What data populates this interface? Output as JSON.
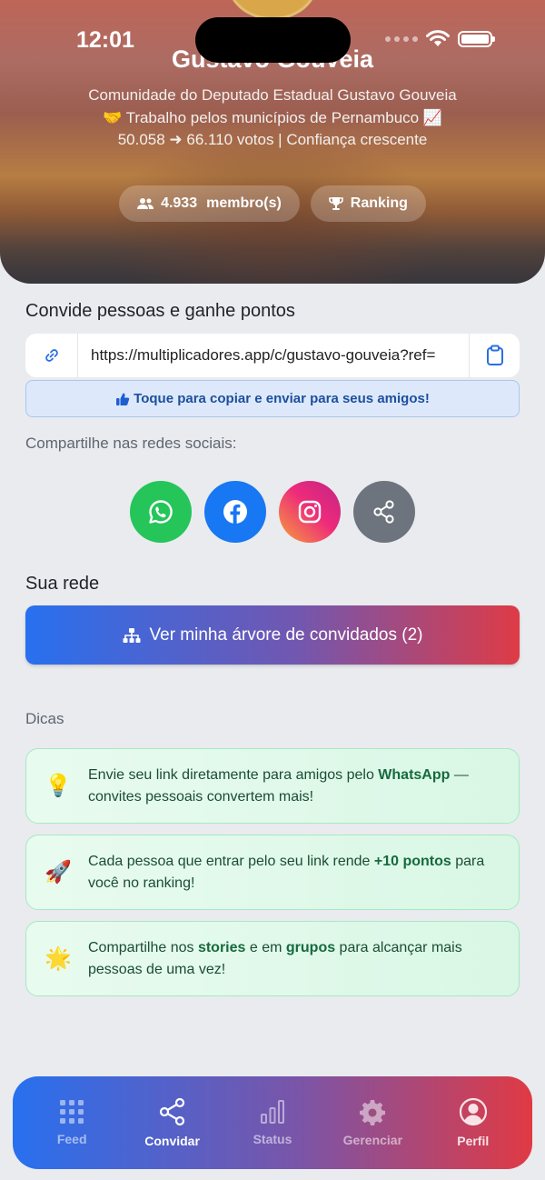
{
  "status_bar": {
    "time": "12:01"
  },
  "community": {
    "name": "Gustavo Gouveia",
    "description": "Comunidade do Deputado Estadual Gustavo Gouveia 🤝 Trabalho pelos municípios de Pernambuco 📈 50.058 ➜ 66.110 votos | Confiança crescente",
    "members_count": "4.933",
    "members_label": "membro(s)",
    "ranking_label": "Ranking"
  },
  "invite": {
    "title": "Convide pessoas e ganhe pontos",
    "link": "https://multiplicadores.app/c/gustavo-gouveia?ref=",
    "copy_hint": "Toque para copiar e enviar para seus amigos!",
    "social_label": "Compartilhe nas redes sociais:",
    "social": [
      {
        "name": "whatsapp",
        "color": "#25c55a"
      },
      {
        "name": "facebook",
        "color": "#1877f2"
      },
      {
        "name": "instagram",
        "color": "#e1306c"
      },
      {
        "name": "share",
        "color": "#6d747d"
      }
    ]
  },
  "network": {
    "title": "Sua rede",
    "tree_button": "Ver minha árvore de convidados (2)"
  },
  "tips": {
    "title": "Dicas",
    "items": [
      {
        "icon": "💡",
        "pre": "Envie seu link diretamente para amigos pelo ",
        "bold": "WhatsApp",
        "post": " — convites pessoais convertem mais!"
      },
      {
        "icon": "🚀",
        "pre": "Cada pessoa que entrar pelo seu link rende ",
        "bold": "+10 pontos",
        "post": " para você no ranking!"
      },
      {
        "icon": "🌟",
        "pre": "Compartilhe nos ",
        "bold": "stories",
        "mid": " e em ",
        "bold2": "grupos",
        "post": " para alcançar mais pessoas de uma vez!"
      }
    ]
  },
  "nav": {
    "items": [
      {
        "label": "Feed"
      },
      {
        "label": "Convidar"
      },
      {
        "label": "Status"
      },
      {
        "label": "Gerenciar"
      },
      {
        "label": "Perfil"
      }
    ],
    "active": "Convidar"
  },
  "colors": {
    "accent_blue": "#2870ef",
    "accent_red": "#e03a44",
    "tip_green": "#166a3e"
  }
}
